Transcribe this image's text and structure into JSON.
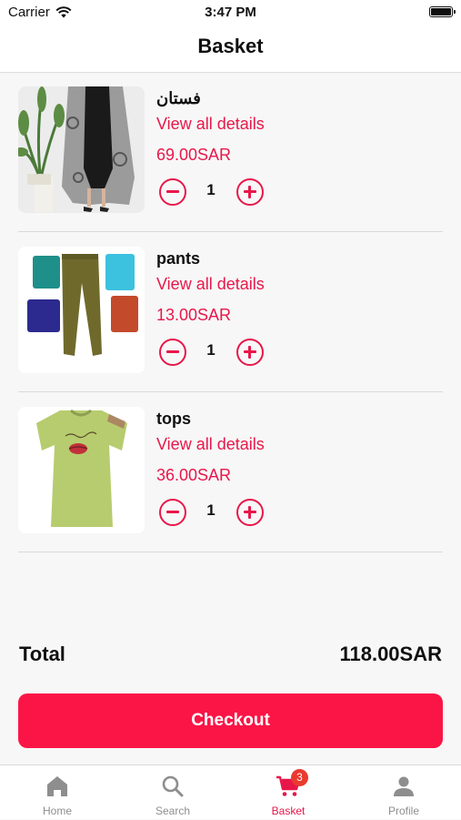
{
  "status_bar": {
    "carrier": "Carrier",
    "time": "3:47 PM"
  },
  "header": {
    "title": "Basket"
  },
  "items": [
    {
      "name": "فستان",
      "details_link": "View all details",
      "price": "69.00SAR",
      "quantity": "1"
    },
    {
      "name": "pants",
      "details_link": "View all details",
      "price": "13.00SAR",
      "quantity": "1"
    },
    {
      "name": "tops",
      "details_link": "View all details",
      "price": "36.00SAR",
      "quantity": "1"
    }
  ],
  "summary": {
    "total_label": "Total",
    "total_value": "118.00SAR",
    "checkout_label": "Checkout"
  },
  "tabs": [
    {
      "label": "Home",
      "icon": "home-icon"
    },
    {
      "label": "Search",
      "icon": "search-icon"
    },
    {
      "label": "Basket",
      "icon": "cart-icon",
      "badge": "3",
      "active": true
    },
    {
      "label": "Profile",
      "icon": "person-icon"
    }
  ],
  "colors": {
    "accent": "#e8174a",
    "checkout": "#fb1546",
    "badge": "#ea3a2e"
  }
}
